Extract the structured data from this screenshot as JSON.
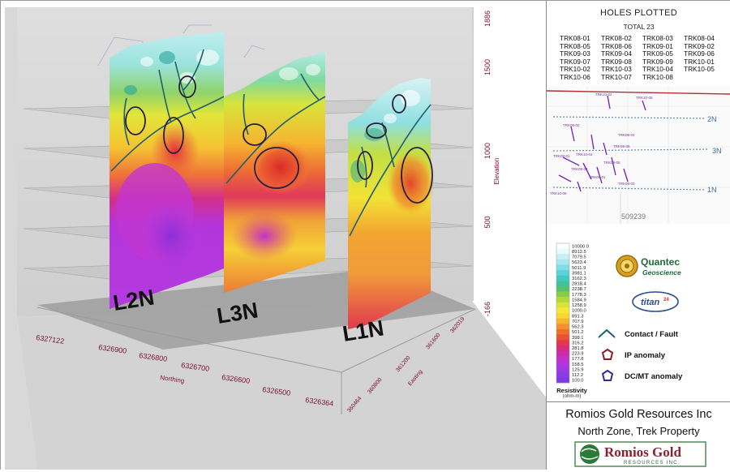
{
  "right_panel": {
    "holes_title": "HOLES PLOTTED",
    "holes_total": "TOTAL 23",
    "holes": [
      "TRK08-01",
      "TRK08-02",
      "TRK08-03",
      "TRK08-04",
      "TRK08-05",
      "TRK08-06",
      "TRK09-01",
      "TRK09-02",
      "TRK09-03",
      "TRK09-04",
      "TRK09-05",
      "TRK09-06",
      "TRK09-07",
      "TRK09-08",
      "TRK09-09",
      "TRK10-01",
      "TRK10-02",
      "TRK10-03",
      "TRK10-04",
      "TRK10-05",
      "TRK10-06",
      "TRK10-07",
      "TRK10-08"
    ],
    "map": {
      "line_labels": [
        "2N",
        "3N",
        "1N"
      ],
      "easting_label": "509239",
      "map_hole_labels": [
        "TRK10-02",
        "TRK10-05",
        "TRK08-02",
        "TRK08-04",
        "TRK08-01",
        "TRK10-04",
        "TRK09-05",
        "TRK10-06",
        "TRK09-01",
        "TRK08-03",
        "TRK09-04",
        "TRK09-06"
      ]
    },
    "resistivity_scale": {
      "title": "Resistivity",
      "units": "(ohm-m)",
      "values": [
        "10000.0",
        "8912.5",
        "7079.5",
        "5623.4",
        "5011.9",
        "3981.1",
        "3162.3",
        "2818.4",
        "2238.7",
        "1778.3",
        "1584.9",
        "1258.9",
        "1000.0",
        "891.3",
        "707.9",
        "562.3",
        "501.2",
        "398.1",
        "316.2",
        "281.8",
        "223.9",
        "177.8",
        "158.5",
        "125.9",
        "112.2",
        "100.0"
      ],
      "colors": [
        "#ffffff",
        "#e6f9fb",
        "#c7f0f4",
        "#a6e8ee",
        "#7fdde6",
        "#58d3db",
        "#41c9c6",
        "#3fc49a",
        "#55c36a",
        "#86cc46",
        "#b2d93c",
        "#d9e33a",
        "#f2e838",
        "#f9d632",
        "#f7b52f",
        "#f3922c",
        "#ee6f2a",
        "#e8522f",
        "#e0394d",
        "#d72c78",
        "#cc2ba5",
        "#c130c8",
        "#b135dc",
        "#9c38e4",
        "#8a3ae6",
        "#7d3be4"
      ]
    },
    "legend": {
      "contact_fault": "Contact / Fault",
      "ip_anomaly": "IP anomaly",
      "dcmt_anomaly": "DC/MT anomaly",
      "contact_color": "#1f5f6e",
      "ip_color": "#8b1a2a",
      "dcmt_color": "#3b2a88"
    },
    "logos": {
      "quantec_line1": "Quantec",
      "quantec_line2": "Geoscience",
      "titan": "titan",
      "titan_sup": "24"
    },
    "company_name": "Romios Gold Resources Inc",
    "property_name": "North Zone, Trek Property",
    "company_logo_text": "Romios Gold",
    "company_logo_sub": "RESOURCES INC."
  },
  "view3d": {
    "section_labels": [
      "L2N",
      "L3N",
      "L1N"
    ],
    "elevation_ticks": [
      "1886",
      "1500",
      "1000",
      "500",
      "-166"
    ],
    "elevation_label": "Elevation",
    "northing_ticks": [
      "6327122",
      "6326900",
      "6326800",
      "6326700",
      "6326600",
      "6326500",
      "6326364"
    ],
    "northing_label": "Northing",
    "easting_ticks": [
      "360464",
      "360800",
      "361200",
      "361600",
      "362019"
    ],
    "easting_label": "Easting"
  }
}
